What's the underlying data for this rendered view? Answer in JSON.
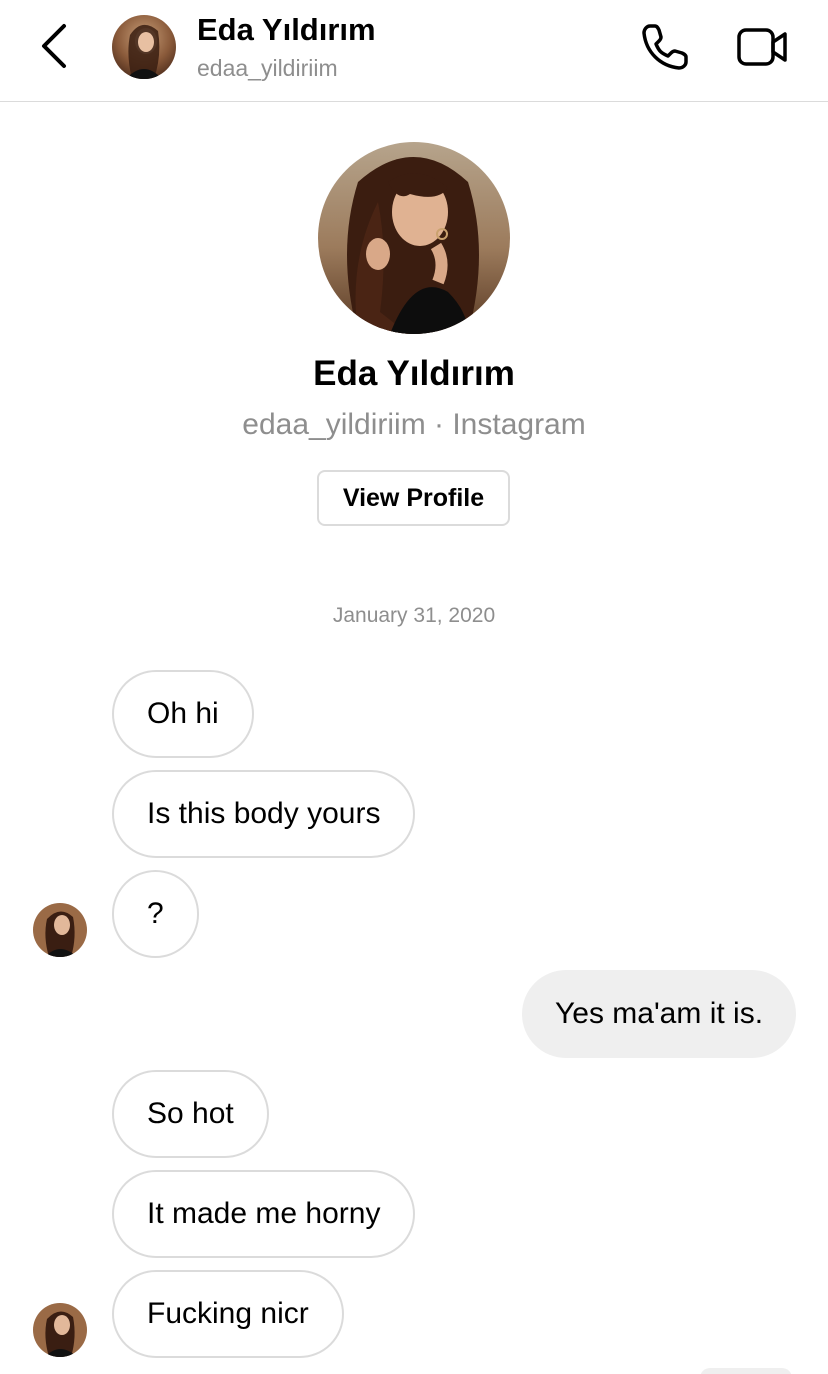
{
  "header": {
    "name": "Eda Yıldırım",
    "username": "edaa_yildiriim",
    "icons": {
      "back": "chevron-left-icon",
      "call": "phone-icon",
      "video": "video-camera-icon"
    }
  },
  "profile": {
    "name": "Eda Yıldırım",
    "subtitle": "edaa_yildiriim · Instagram",
    "view_profile_label": "View Profile"
  },
  "thread": {
    "date": "January 31, 2020",
    "messages": [
      {
        "direction": "incoming",
        "text": "Oh hi"
      },
      {
        "direction": "incoming",
        "text": "Is this body yours"
      },
      {
        "direction": "incoming",
        "text": "?"
      },
      {
        "direction": "outgoing",
        "text": "Yes ma'am it is."
      },
      {
        "direction": "incoming",
        "text": "So hot"
      },
      {
        "direction": "incoming",
        "text": "It made me horny"
      },
      {
        "direction": "incoming",
        "text": "Fucking nicr"
      }
    ]
  },
  "colors": {
    "incoming_border": "#dbdbdb",
    "outgoing_bg": "#efefef",
    "secondary_text": "#8e8e8e",
    "divider": "#dbdbdb"
  }
}
